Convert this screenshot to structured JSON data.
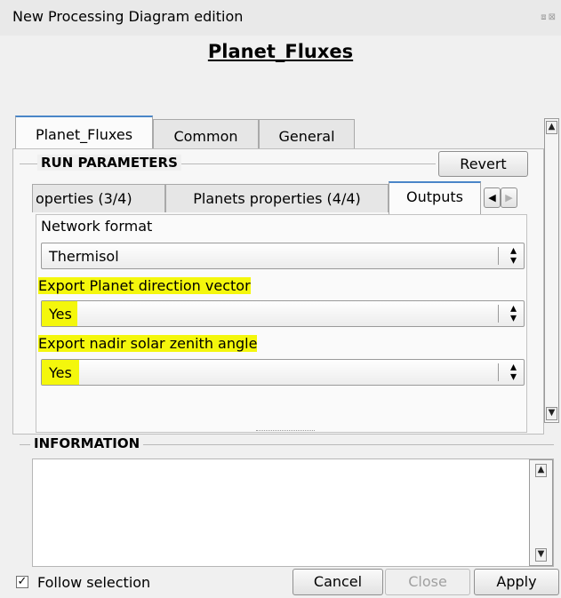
{
  "window": {
    "title": "New Processing Diagram edition"
  },
  "heading": "Planet_Fluxes",
  "outer_tabs": [
    "Planet_Fluxes",
    "Common",
    "General"
  ],
  "run_parameters": {
    "title": "RUN PARAMETERS",
    "revert_label": "Revert",
    "inner_tabs": [
      "operties (3/4)",
      "Planets properties (4/4)",
      "Outputs"
    ],
    "fields": [
      {
        "label": "Network format",
        "value": "Thermisol",
        "highlighted": false
      },
      {
        "label": "Export Planet direction vector",
        "value": "Yes",
        "highlighted": true
      },
      {
        "label": "Export nadir solar zenith angle",
        "value": "Yes",
        "highlighted": true
      }
    ]
  },
  "information": {
    "title": "INFORMATION"
  },
  "footer": {
    "follow_selection_label": "Follow selection",
    "follow_selection_checked": true,
    "cancel_label": "Cancel",
    "close_label": "Close",
    "apply_label": "Apply"
  },
  "colors": {
    "highlight": "#f4f70c",
    "tab_accent": "#4a86c8"
  },
  "icons": {
    "checkmark": "✓",
    "combo_arrows": "updown-arrows-icon"
  }
}
